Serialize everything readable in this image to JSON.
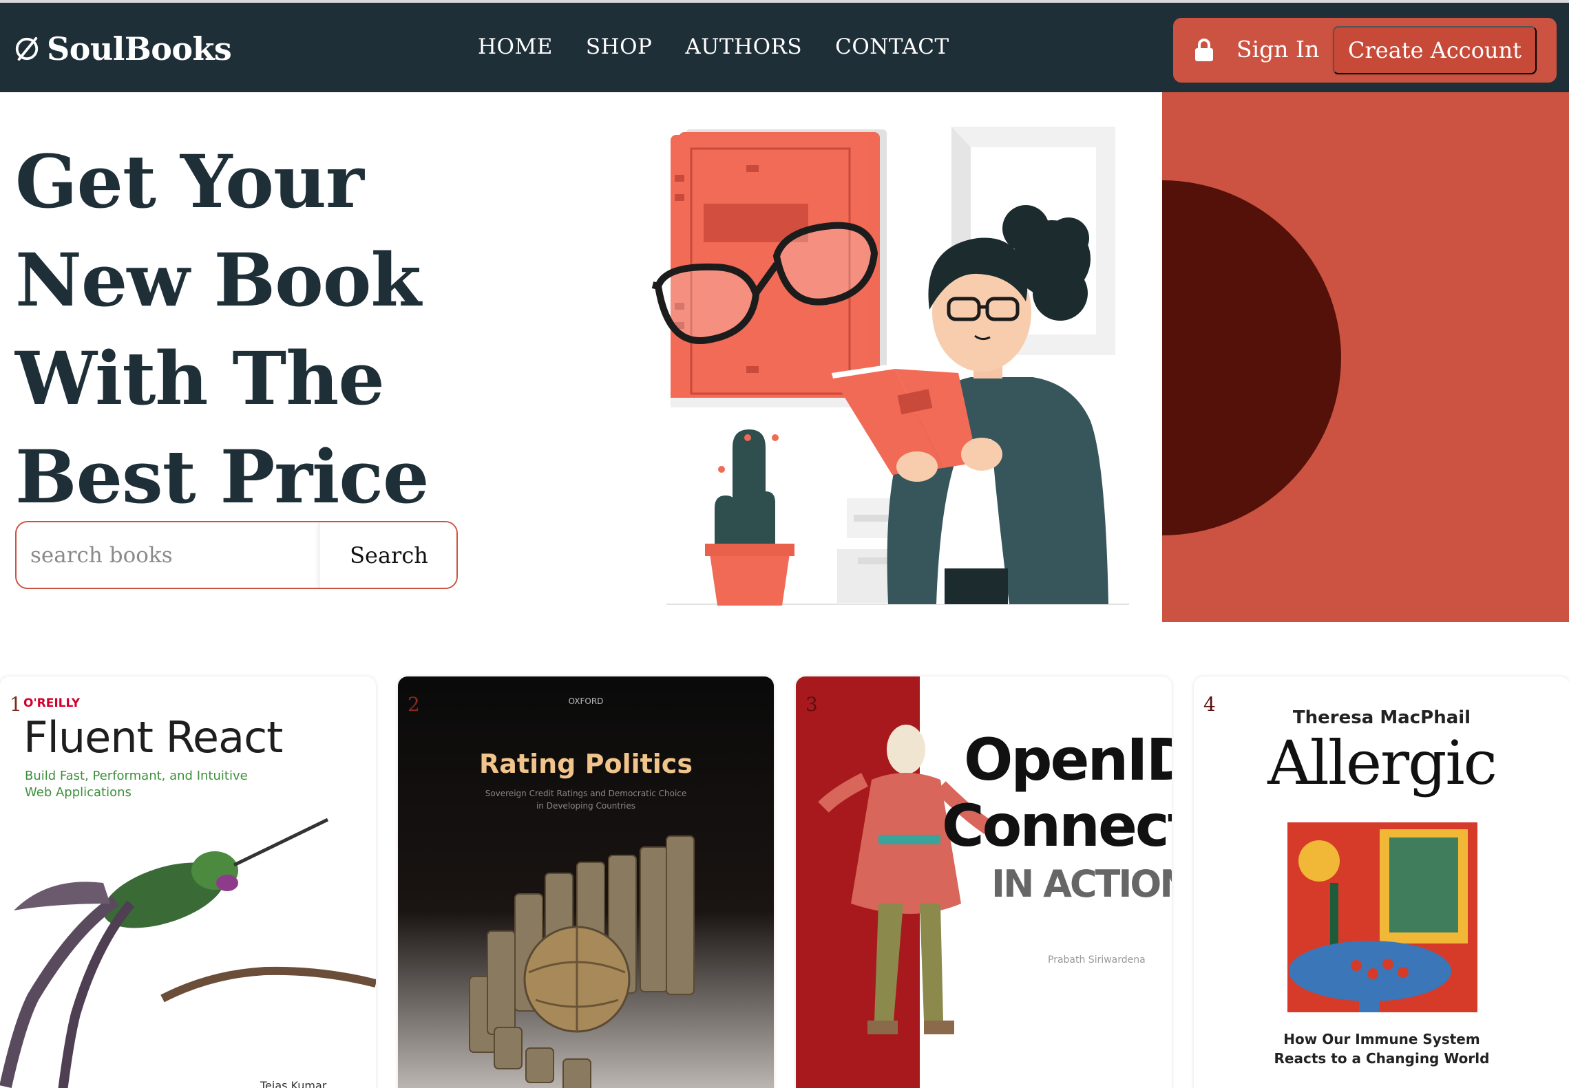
{
  "brand": {
    "name": "SoulBooks",
    "logo_icon": "slashed-circle-logo-icon"
  },
  "nav": {
    "links": [
      "HOME",
      "SHOP",
      "AUTHORS",
      "CONTACT"
    ]
  },
  "auth": {
    "lock_icon": "lock-icon",
    "sign_in": "Sign In",
    "create_account": "Create Account"
  },
  "hero": {
    "title_lines": [
      "Get Your",
      "New Book",
      "With The",
      "Best Price"
    ],
    "search_placeholder": "search books",
    "search_button": "Search"
  },
  "colors": {
    "navbar": "#1f2f38",
    "accent": "#cc5341",
    "dark_accent": "#53110a",
    "title": "#1f2f38"
  },
  "books": [
    {
      "number": "1",
      "publisher": "O'REILLY",
      "title": "Fluent React",
      "subtitle_line1": "Build Fast, Performant, and Intuitive",
      "subtitle_line2": "Web Applications",
      "author": "Tejas Kumar"
    },
    {
      "number": "2",
      "publisher": "OXFORD",
      "title": "Rating Politics",
      "subtitle_line1": "Sovereign Credit Ratings and Democratic Choice",
      "subtitle_line2": "in Developing Countries"
    },
    {
      "number": "3",
      "title_line1": "OpenID",
      "title_line2": "Connect",
      "title_line3": "IN ACTION",
      "author": "Prabath Siriwardena"
    },
    {
      "number": "4",
      "author": "Theresa MacPhail",
      "title": "Allergic",
      "subtitle_line1": "How Our Immune System",
      "subtitle_line2": "Reacts to a Changing World"
    }
  ]
}
